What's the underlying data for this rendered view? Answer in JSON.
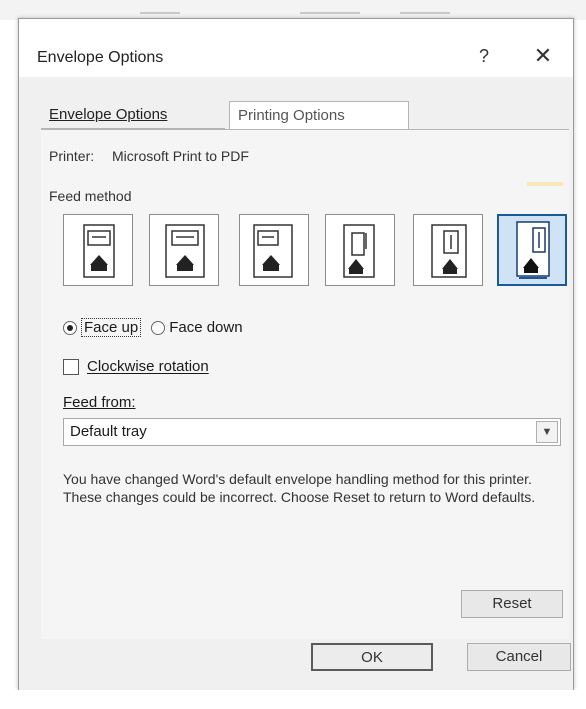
{
  "dialog": {
    "title": "Envelope Options",
    "help_icon": "?",
    "close_icon": "✕"
  },
  "tabs": [
    {
      "label": "Envelope Options",
      "active": false
    },
    {
      "label": "Printing Options",
      "active": true
    }
  ],
  "printing": {
    "printer_label": "Printer:",
    "printer_name": "Microsoft Print to PDF",
    "feed_method_label": "Feed method",
    "feed_methods": [
      {
        "icon": "feed-method-1-icon",
        "selected": false
      },
      {
        "icon": "feed-method-2-icon",
        "selected": false
      },
      {
        "icon": "feed-method-3-icon",
        "selected": false
      },
      {
        "icon": "feed-method-4-icon",
        "selected": false
      },
      {
        "icon": "feed-method-5-icon",
        "selected": false
      },
      {
        "icon": "feed-method-6-icon",
        "selected": true
      }
    ],
    "face_up_label": "Face up",
    "face_down_label": "Face down",
    "face_up_selected": true,
    "clockwise_label": "Clockwise rotation",
    "clockwise_checked": false,
    "feed_from_label": "Feed from:",
    "feed_from_value": "Default tray",
    "message_line1": "You have changed Word's default envelope handling method for this printer.",
    "message_line2": "These changes could be incorrect. Choose Reset to return to Word defaults.",
    "reset_label": "Reset"
  },
  "footer": {
    "ok_label": "OK",
    "cancel_label": "Cancel"
  },
  "colors": {
    "selected_tile_bg": "#cfe3f5",
    "selected_tile_border": "#1a5a9a"
  }
}
